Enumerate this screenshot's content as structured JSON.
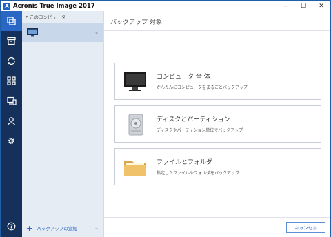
{
  "window": {
    "title": "Acronis True Image 2017",
    "app_icon_letter": "A",
    "controls": {
      "minimize": "–",
      "maximize": "☐",
      "close": "✕"
    }
  },
  "rail": {
    "items": [
      {
        "icon": "copy-backup-icon"
      },
      {
        "icon": "archive-icon"
      },
      {
        "icon": "sync-icon"
      },
      {
        "icon": "grid-icon"
      },
      {
        "icon": "devices-icon"
      },
      {
        "icon": "account-icon"
      },
      {
        "icon": "settings-gear-icon"
      },
      {
        "icon": "help-icon"
      }
    ]
  },
  "sidebar": {
    "header": "このコンピュータ",
    "item_icon": "monitor-icon",
    "footer_label": "バックアップの追加"
  },
  "main": {
    "title": "バックアップ 対象",
    "options": [
      {
        "title": "コンピュータ 全 体",
        "desc": "かんたんにコンピュータをまるごとバックアップ",
        "icon": "computer-monitor-icon"
      },
      {
        "title": "ディスクとパーティション",
        "desc": "ディスクやパーティション単位でバックアップ",
        "icon": "hard-disk-icon"
      },
      {
        "title": "ファイルとフォルダ",
        "desc": "指定したファイルやフォルダをバックアップ",
        "icon": "folder-icon"
      }
    ],
    "cancel_label": "キャンセル"
  },
  "colors": {
    "rail_bg": "#15305a",
    "rail_active": "#2a67c4",
    "sidebar_bg": "#e6ecf3",
    "sidebar_selected": "#c9d7ea",
    "accent": "#2a67c4"
  }
}
